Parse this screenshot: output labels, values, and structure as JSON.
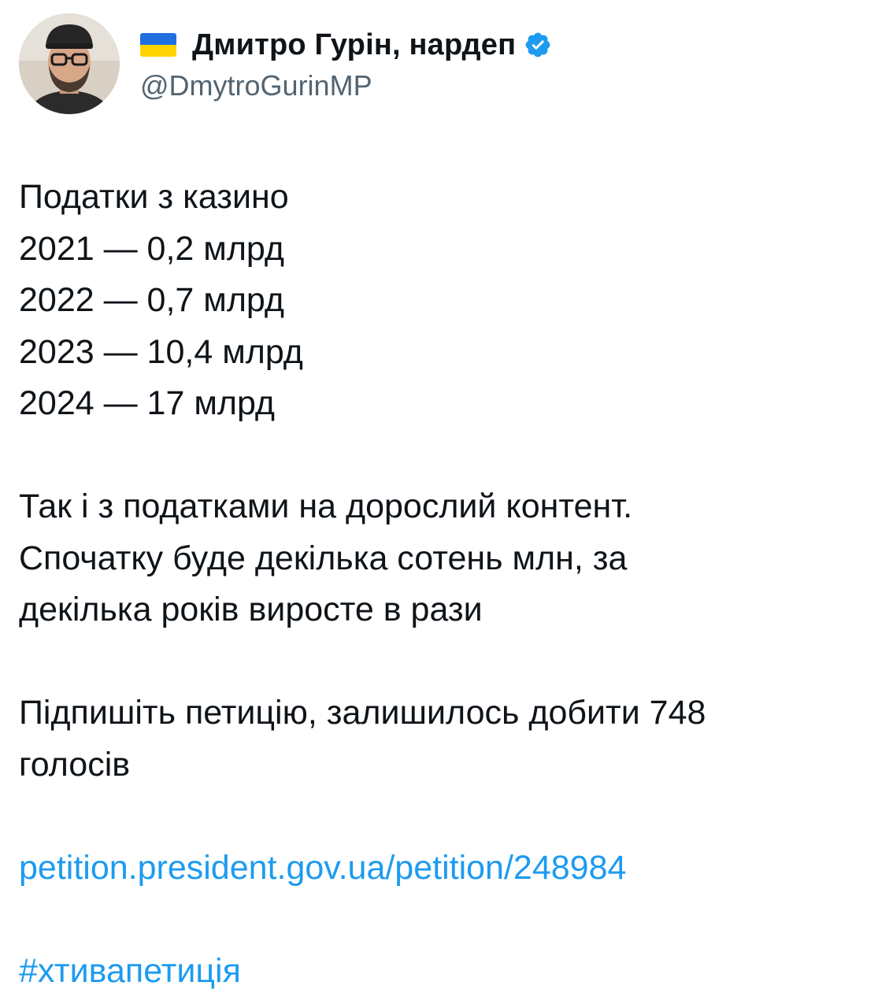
{
  "author": {
    "display_name": "Дмитро Гурін, нардеп",
    "handle": "@DmytroGurinMP",
    "flag_colors": [
      "#1f6fe0",
      "#ffd400"
    ],
    "verified_badge_color": "#1d9bf0",
    "avatar_icon": "avatar-photo",
    "flag_icon": "ukraine-flag-icon",
    "verified_icon": "verified-badge-icon"
  },
  "tweet": {
    "intro": "Податки з казино",
    "stats": [
      "2021 — 0,2 млрд",
      "2022 — 0,7 млрд",
      "2023 — 10,4 млрд",
      "2024 — 17 млрд"
    ],
    "paragraph2": [
      "Так і з податками на дорослий контент.",
      "Спочатку буде декілька сотень млн, за",
      "декілька років виросте в рази"
    ],
    "paragraph3": [
      "Підпишіть петицію, залишилось добити 748",
      "голосів"
    ],
    "link": "petition.president.gov.ua/petition/248984",
    "hashtag": "#хтивапетиція"
  },
  "colors": {
    "text": "#0f1419",
    "secondary": "#536471",
    "accent": "#1d9bf0"
  }
}
